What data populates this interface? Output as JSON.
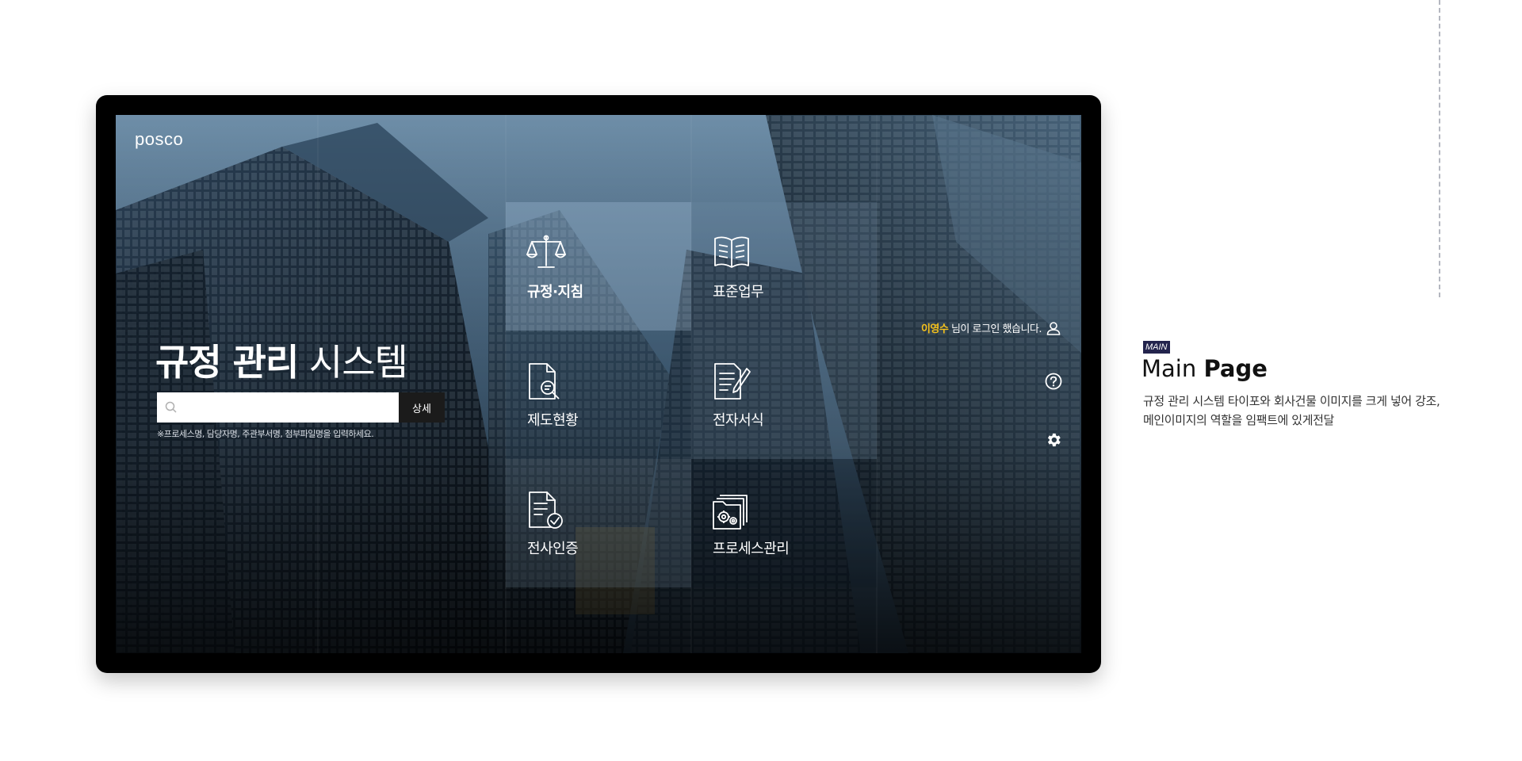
{
  "screen": {
    "logo": "posco",
    "title_bold": "규정 관리",
    "title_light": " 시스템",
    "search": {
      "placeholder": "",
      "button_label": "상세"
    },
    "hint": "※프로세스명, 담당자명, 주관부서명, 첨부파일명을 입력하세요.",
    "tiles": [
      {
        "label": "규정·지침",
        "icon": "scales-icon"
      },
      {
        "label": "표준업무",
        "icon": "book-icon"
      },
      {
        "label": "제도현황",
        "icon": "document-search-icon"
      },
      {
        "label": "전자서식",
        "icon": "document-pen-icon"
      },
      {
        "label": "전사인증",
        "icon": "document-check-icon"
      },
      {
        "label": "프로세스관리",
        "icon": "folder-gears-icon"
      }
    ],
    "user": {
      "name": "이영수",
      "suffix": " 님이 로그인 했습니다."
    },
    "icons": {
      "user": "user-icon",
      "help": "help-icon",
      "settings": "gear-icon"
    },
    "accent_color": "#f6c21c"
  },
  "panel": {
    "tag": "MAIN",
    "title_light": "Main ",
    "title_bold": "Page",
    "desc_lines": [
      "규정 관리 시스템 타이포와 회사건물 이미지를 크게 넣어 강조,",
      "메인이미지의 역할을 임팩트에 있게전달"
    ]
  }
}
